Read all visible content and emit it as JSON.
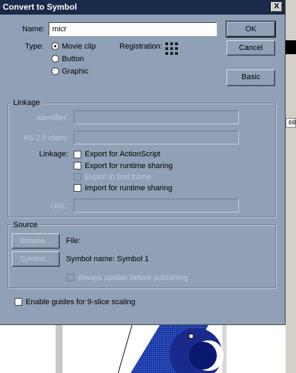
{
  "dialog": {
    "title": "Convert to Symbol",
    "close_label": "X"
  },
  "name_field": {
    "label": "Name:",
    "value": "micr"
  },
  "type": {
    "label": "Type:",
    "options": [
      "Movie clip",
      "Button",
      "Graphic"
    ],
    "selected": "Movie clip"
  },
  "registration": {
    "label": "Registration:"
  },
  "buttons": {
    "ok": "OK",
    "cancel": "Cancel",
    "basic": "Basic"
  },
  "linkage": {
    "group_title": "Linkage",
    "identifier_label": "Identifier:",
    "identifier_value": "",
    "as_class_label": "AS 2.0 class:",
    "as_class_value": "",
    "linkage_label": "Linkage:",
    "options": [
      "Export for ActionScript",
      "Export for runtime sharing",
      "Export in first frame",
      "Import for runtime sharing"
    ],
    "url_label": "URL:",
    "url_value": ""
  },
  "source": {
    "group_title": "Source",
    "browse_label": "Browse...",
    "file_label": "File:",
    "symbol_button": "Symbol...",
    "symbol_name": "Symbol name: Symbol 1",
    "always_update": "Always update before publishing"
  },
  "nine_slice": {
    "label": "Enable guides for 9-slice scaling"
  },
  "background": {
    "ruler_value": "60",
    "accent": "#1a3aa8",
    "dialog_bg": "#90a0b6",
    "title_bg": "#1a2a4a"
  }
}
